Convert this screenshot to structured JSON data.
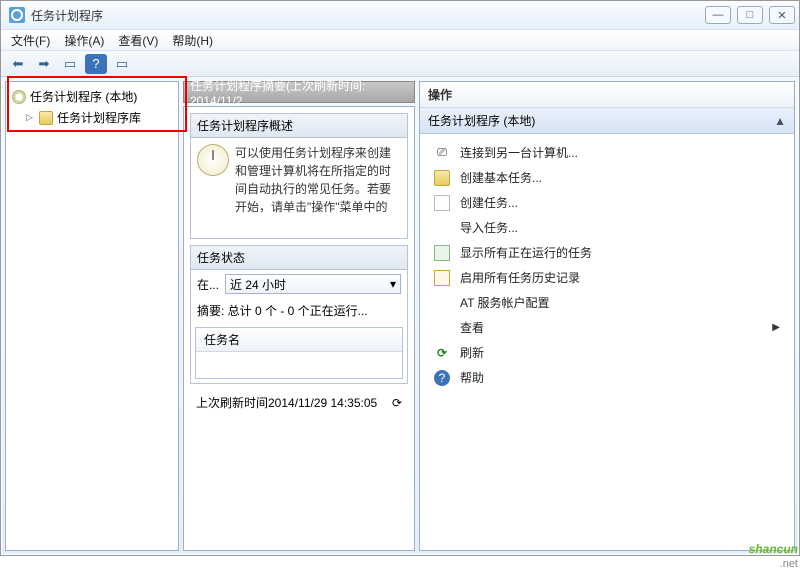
{
  "window": {
    "title": "任务计划程序",
    "pid_badge": "",
    "controls": {
      "min": "—",
      "max": "□",
      "close": "✕"
    }
  },
  "menu": {
    "file": "文件(F)",
    "action": "操作(A)",
    "view": "查看(V)",
    "help": "帮助(H)"
  },
  "tree": {
    "root": "任务计划程序 (本地)",
    "lib": "任务计划程序库"
  },
  "middle": {
    "header": "任务计划程序摘要(上次刷新时间: 2014/11/2",
    "overview_title": "任务计划程序概述",
    "overview_text": "可以使用任务计划程序来创建和管理计算机将在所指定的时间自动执行的常见任务。若要开始，请单击\"操作\"菜单中的",
    "status_title": "任务状态",
    "status_label": "在...",
    "status_select": "近 24 小时",
    "summary": "摘要: 总计 0 个 - 0 个正在运行...",
    "tasklist_header": "任务名",
    "last_refresh": "上次刷新时间2014/11/29 14:35:05"
  },
  "right": {
    "title": "操作",
    "subtitle": "任务计划程序 (本地)",
    "actions": {
      "connect": "连接到另一台计算机...",
      "create_basic": "创建基本任务...",
      "create_task": "创建任务...",
      "import": "导入任务...",
      "show_running": "显示所有正在运行的任务",
      "enable_history": "启用所有任务历史记录",
      "at_service": "AT 服务帐户配置",
      "view": "查看",
      "refresh": "刷新",
      "help": "帮助"
    }
  },
  "watermark": {
    "brand": "shancun",
    "domain": ".net"
  }
}
